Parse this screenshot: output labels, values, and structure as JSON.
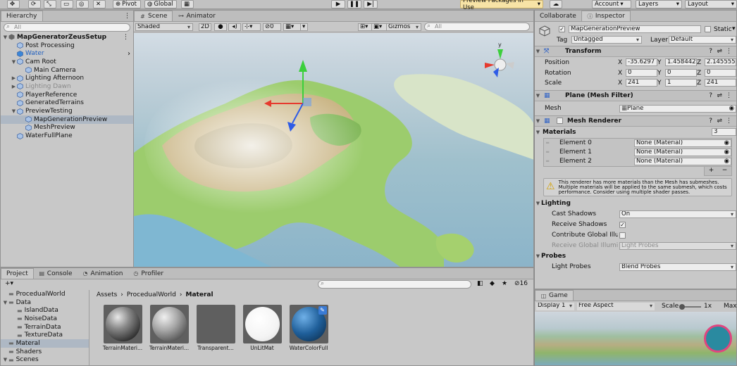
{
  "toolbar": {
    "pivot": "Pivot",
    "global": "Global",
    "preview_packages": "Preview Packages in Use",
    "account": "Account",
    "layers": "Layers",
    "layout": "Layout"
  },
  "hierarchy": {
    "tab": "Hierarchy",
    "search_placeholder": "All",
    "root": "MapGeneratorZeusSetup",
    "items": [
      {
        "label": "Post Processing",
        "indent": 1,
        "arrow": ""
      },
      {
        "label": "Water",
        "indent": 1,
        "arrow": "",
        "blue": true
      },
      {
        "label": "Cam Root",
        "indent": 1,
        "arrow": "▼"
      },
      {
        "label": "Main Camera",
        "indent": 2,
        "arrow": ""
      },
      {
        "label": "Lighting Afternoon",
        "indent": 1,
        "arrow": "▶"
      },
      {
        "label": "Lighting Dawn",
        "indent": 1,
        "arrow": "▶",
        "dim": true
      },
      {
        "label": "PlayerReference",
        "indent": 1,
        "arrow": ""
      },
      {
        "label": "GeneratedTerrains",
        "indent": 1,
        "arrow": ""
      },
      {
        "label": "PreviewTesting",
        "indent": 1,
        "arrow": "▼"
      },
      {
        "label": "MapGenerationPreview",
        "indent": 2,
        "arrow": "",
        "selected": true
      },
      {
        "label": "MeshPreview",
        "indent": 2,
        "arrow": ""
      },
      {
        "label": "WaterFullPlane",
        "indent": 1,
        "arrow": ""
      }
    ]
  },
  "scene": {
    "tab_scene": "Scene",
    "tab_animator": "Animator",
    "shading": "Shaded",
    "mode_2d": "2D",
    "hidden_count": "0",
    "gizmos": "Gizmos",
    "search_placeholder": "All",
    "axis_y": "y"
  },
  "inspector": {
    "tab_collaborate": "Collaborate",
    "tab_inspector": "Inspector",
    "object_name": "MapGenerationPreview",
    "static_label": "Static",
    "tag_label": "Tag",
    "tag_value": "Untagged",
    "layer_label": "Layer",
    "layer_value": "Default",
    "transform": {
      "title": "Transform",
      "rows": [
        {
          "label": "Position",
          "x": "-35.6297",
          "y": "1.458442",
          "z": "2.145555"
        },
        {
          "label": "Rotation",
          "x": "0",
          "y": "0",
          "z": "0"
        },
        {
          "label": "Scale",
          "x": "241",
          "y": "1",
          "z": "241"
        }
      ]
    },
    "mesh_filter": {
      "title": "Plane (Mesh Filter)",
      "mesh_label": "Mesh",
      "mesh_value": "Plane"
    },
    "mesh_renderer": {
      "title": "Mesh Renderer",
      "materials_label": "Materials",
      "materials_count": "3",
      "elements": [
        {
          "label": "Element 0",
          "value": "None (Material)"
        },
        {
          "label": "Element 1",
          "value": "None (Material)"
        },
        {
          "label": "Element 2",
          "value": "None (Material)"
        }
      ],
      "warning": "This renderer has more materials than the Mesh has submeshes. Multiple materials will be applied to the same submesh, which costs performance. Consider using multiple shader passes.",
      "lighting_label": "Lighting",
      "cast_shadows_label": "Cast Shadows",
      "cast_shadows_value": "On",
      "receive_shadows_label": "Receive Shadows",
      "contribute_gi_label": "Contribute Global Illum",
      "receive_gi_label": "Receive Global Illumin",
      "receive_gi_value": "Light Probes",
      "probes_label": "Probes",
      "light_probes_label": "Light Probes",
      "light_probes_value": "Blend Probes"
    }
  },
  "game": {
    "tab": "Game",
    "display": "Display 1",
    "aspect": "Free Aspect",
    "scale_label": "Scale",
    "scale_value": "1x",
    "max_label": "Max"
  },
  "project": {
    "tab_project": "Project",
    "tab_console": "Console",
    "tab_animation": "Animation",
    "tab_profiler": "Profiler",
    "hidden_count": "16",
    "breadcrumb": [
      "Assets",
      "ProcedualWorld",
      "Materal"
    ],
    "folders": [
      {
        "label": "ProcedualWorld",
        "indent": 0,
        "arrow": ""
      },
      {
        "label": "Data",
        "indent": 0,
        "arrow": "▼"
      },
      {
        "label": "IslandData",
        "indent": 1,
        "arrow": ""
      },
      {
        "label": "NoiseData",
        "indent": 1,
        "arrow": ""
      },
      {
        "label": "TerrainData",
        "indent": 1,
        "arrow": ""
      },
      {
        "label": "TextureData",
        "indent": 1,
        "arrow": ""
      },
      {
        "label": "Materal",
        "indent": 0,
        "arrow": "",
        "selected": true
      },
      {
        "label": "Shaders",
        "indent": 0,
        "arrow": ""
      },
      {
        "label": "Scenes",
        "indent": 0,
        "arrow": "▼"
      }
    ],
    "assets": [
      {
        "label": "TerrainMateri...",
        "kind": "dark"
      },
      {
        "label": "TerrainMateri...",
        "kind": "grey"
      },
      {
        "label": "Transparent...",
        "kind": "flat"
      },
      {
        "label": "UnLitMat",
        "kind": "white"
      },
      {
        "label": "WaterColorFull",
        "kind": "blue"
      }
    ]
  },
  "colors": {
    "accent_selection": "#aeb8c4",
    "gizmo_x": "#e63a2e",
    "gizmo_y": "#3ccf3c",
    "gizmo_z": "#2f5ce6",
    "water_material": "#1f5f9a"
  }
}
